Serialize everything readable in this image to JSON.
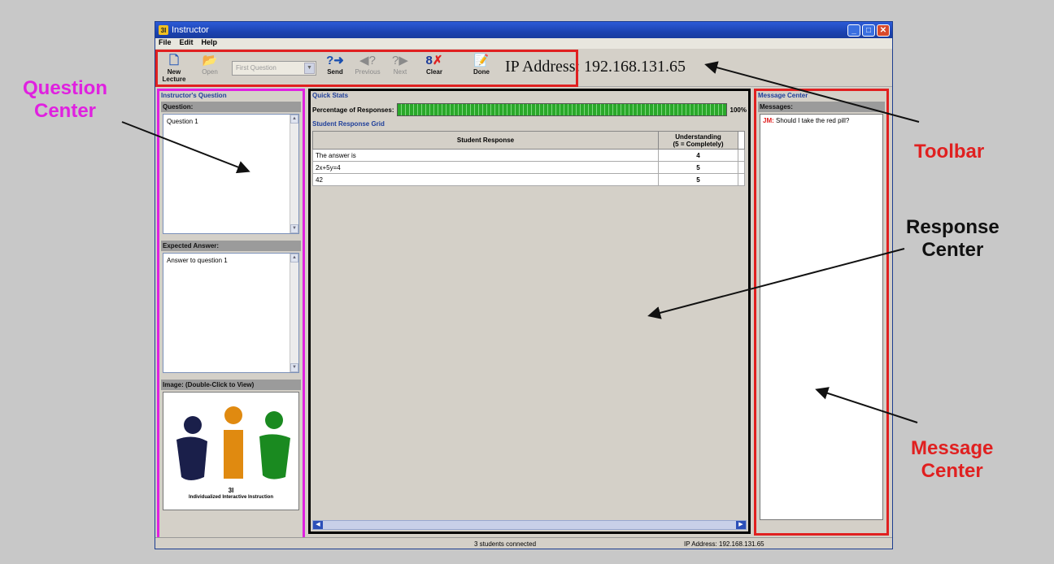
{
  "window": {
    "title": "Instructor",
    "app_icon": "3I"
  },
  "menu": [
    "File",
    "Edit",
    "Help"
  ],
  "toolbar": {
    "new_lecture": "New\nLecture",
    "open": "Open",
    "question_select": "First Question",
    "send": "Send",
    "previous": "Previous",
    "next": "Next",
    "clear": "Clear",
    "done": "Done",
    "ip_address": "IP Address: 192.168.131.65"
  },
  "question_center": {
    "header": "Instructor's Question",
    "question_label": "Question:",
    "question_text": "Question 1",
    "expected_label": "Expected Answer:",
    "expected_text": "Answer to question 1",
    "image_label": "Image: (Double-Click to View)",
    "logo_title": "3I",
    "logo_caption": "Individualized Interactive Instruction"
  },
  "response_center": {
    "quick_stats": "Quick Stats",
    "percentage_label": "Percentage of Responses:",
    "percentage_value": "100%",
    "percentage_fraction": 1.0,
    "grid_title": "Student Response Grid",
    "columns": [
      "Student Response",
      "Understanding\n(5 = Completely)"
    ],
    "rows": [
      {
        "response": "The answer is",
        "understanding": "4"
      },
      {
        "response": "2x+5y=4",
        "understanding": "5"
      },
      {
        "response": "42",
        "understanding": "5"
      }
    ]
  },
  "message_center": {
    "header": "Message Center",
    "messages_label": "Messages:",
    "from": "JM:",
    "text": "Should I take the red pill?"
  },
  "status": {
    "connected": "3 students connected",
    "ip": "IP Address: 192.168.131.65"
  },
  "annotations": {
    "question_center": "Question\nCenter",
    "toolbar": "Toolbar",
    "response_center": "Response\nCenter",
    "message_center": "Message\nCenter"
  },
  "colors": {
    "question_center": "#e020e0",
    "toolbar": "#e02020",
    "response_center": "#000000",
    "message_center": "#e02020",
    "progress": "#2aa82a"
  }
}
